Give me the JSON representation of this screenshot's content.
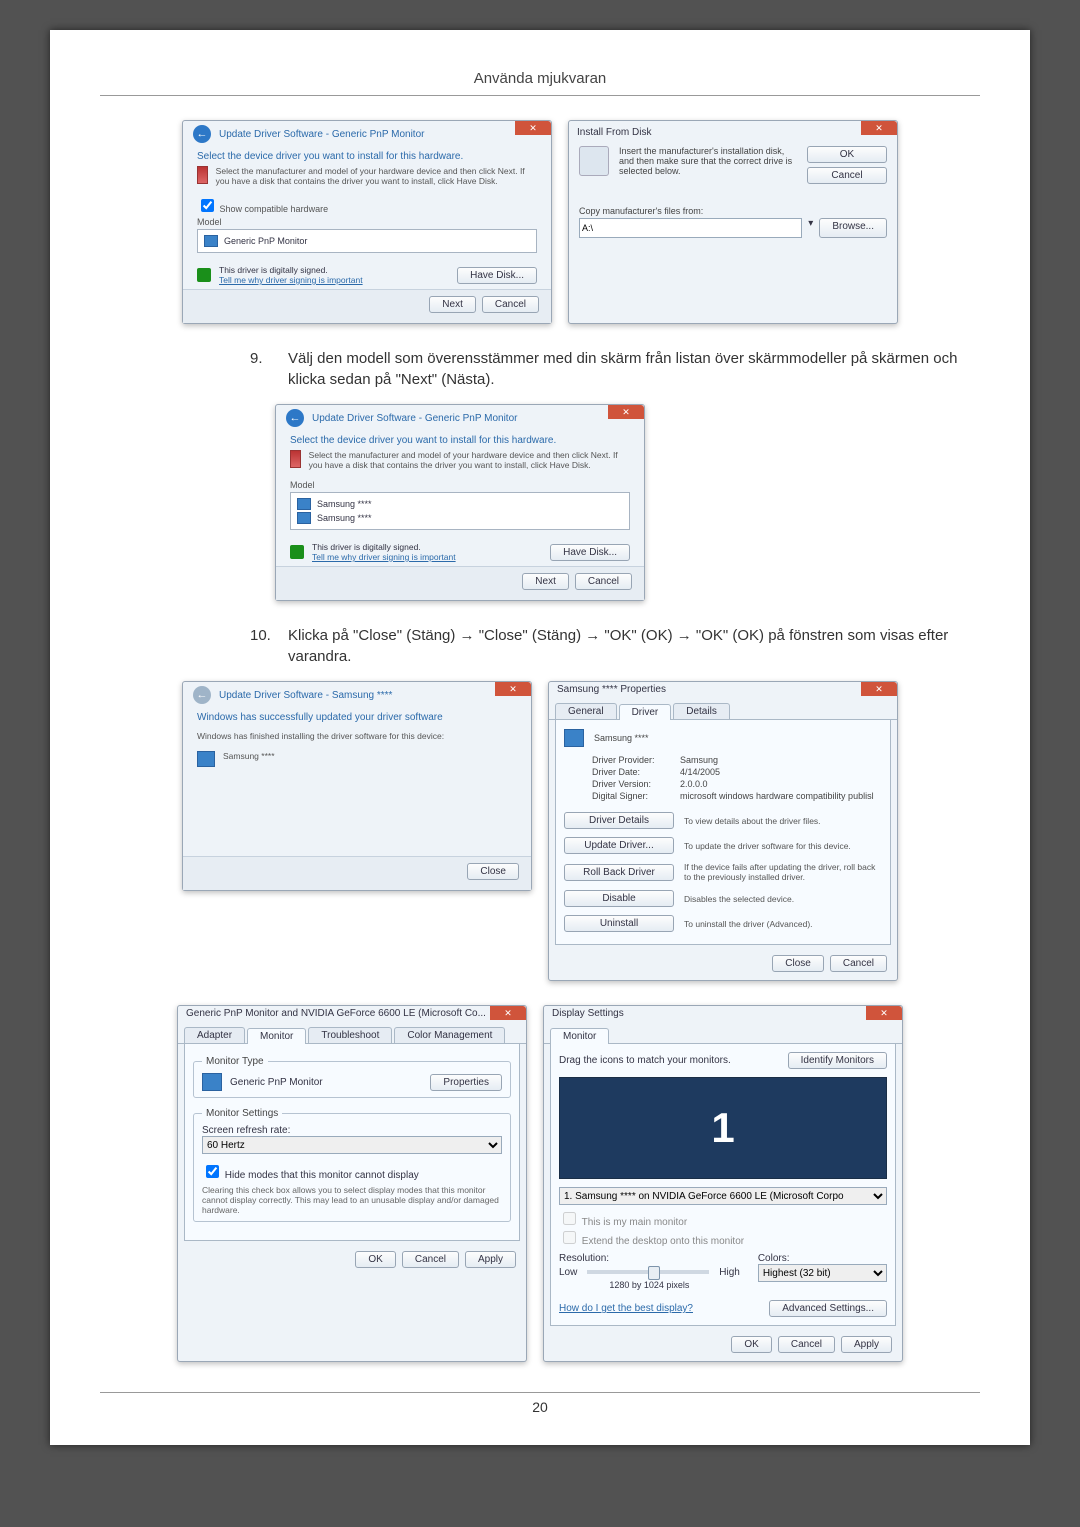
{
  "header_title": "Använda mjukvaran",
  "page_number": "20",
  "step9": {
    "num": "9.",
    "text": "Välj den modell som överensstämmer med din skärm från listan över skärmmodeller på skärmen och klicka sedan på \"Next\" (Nästa)."
  },
  "step10": {
    "num": "10.",
    "text": "Klicka på \"Close\" (Stäng) → \"Close\" (Stäng) → \"OK\" (OK) → \"OK\" (OK) på fönstren som visas efter varandra."
  },
  "wizA": {
    "crumb": "Update Driver Software - Generic PnP Monitor",
    "title": "Select the device driver you want to install for this hardware.",
    "instr": "Select the manufacturer and model of your hardware device and then click Next. If you have a disk that contains the driver you want to install, click Have Disk.",
    "check_compat": "Show compatible hardware",
    "model_lbl": "Model",
    "model_item": "Generic PnP Monitor",
    "signed": "This driver is digitally signed.",
    "signed_link": "Tell me why driver signing is important",
    "have_disk": "Have Disk...",
    "next": "Next",
    "cancel": "Cancel"
  },
  "ifd": {
    "title": "Install From Disk",
    "msg": "Insert the manufacturer's installation disk, and then make sure that the correct drive is selected below.",
    "ok": "OK",
    "cancel": "Cancel",
    "copy_lbl": "Copy manufacturer's files from:",
    "drive": "A:\\",
    "browse": "Browse..."
  },
  "wizB": {
    "crumb": "Update Driver Software - Generic PnP Monitor",
    "title": "Select the device driver you want to install for this hardware.",
    "instr": "Select the manufacturer and model of your hardware device and then click Next. If you have a disk that contains the driver you want to install, click Have Disk.",
    "model_lbl": "Model",
    "item1": "Samsung ****",
    "item2": "Samsung ****",
    "signed": "This driver is digitally signed.",
    "signed_link": "Tell me why driver signing is important",
    "have_disk": "Have Disk...",
    "next": "Next",
    "cancel": "Cancel"
  },
  "wizC": {
    "crumb": "Update Driver Software - Samsung ****",
    "title": "Windows has successfully updated your driver software",
    "sub": "Windows has finished installing the driver software for this device:",
    "device": "Samsung ****",
    "close": "Close"
  },
  "props": {
    "title": "Samsung **** Properties",
    "tab_general": "General",
    "tab_driver": "Driver",
    "tab_details": "Details",
    "device": "Samsung ****",
    "provider_k": "Driver Provider:",
    "provider_v": "Samsung",
    "date_k": "Driver Date:",
    "date_v": "4/14/2005",
    "ver_k": "Driver Version:",
    "ver_v": "2.0.0.0",
    "signer_k": "Digital Signer:",
    "signer_v": "microsoft windows hardware compatibility publisl",
    "b1": "Driver Details",
    "d1": "To view details about the driver files.",
    "b2": "Update Driver...",
    "d2": "To update the driver software for this device.",
    "b3": "Roll Back Driver",
    "d3": "If the device fails after updating the driver, roll back to the previously installed driver.",
    "b4": "Disable",
    "d4": "Disables the selected device.",
    "b5": "Uninstall",
    "d5": "To uninstall the driver (Advanced).",
    "close": "Close",
    "cancel": "Cancel"
  },
  "mon": {
    "title": "Generic PnP Monitor and NVIDIA GeForce 6600 LE (Microsoft Co...",
    "tab_adapter": "Adapter",
    "tab_monitor": "Monitor",
    "tab_trouble": "Troubleshoot",
    "tab_color": "Color Management",
    "type_legend": "Monitor Type",
    "type_value": "Generic PnP Monitor",
    "properties": "Properties",
    "settings_legend": "Monitor Settings",
    "rate_lbl": "Screen refresh rate:",
    "rate_val": "60 Hertz",
    "hide": "Hide modes that this monitor cannot display",
    "hide_note": "Clearing this check box allows you to select display modes that this monitor cannot display correctly. This may lead to an unusable display and/or damaged hardware.",
    "ok": "OK",
    "cancel": "Cancel",
    "apply": "Apply"
  },
  "disp": {
    "title": "Display Settings",
    "tab": "Monitor",
    "drag": "Drag the icons to match your monitors.",
    "identify": "Identify Monitors",
    "preview_num": "1",
    "select": "1. Samsung **** on NVIDIA GeForce 6600 LE (Microsoft Corpo",
    "main": "This is my main monitor",
    "extend": "Extend the desktop onto this monitor",
    "res_lbl": "Resolution:",
    "low": "Low",
    "high": "High",
    "res_val": "1280 by 1024 pixels",
    "col_lbl": "Colors:",
    "col_val": "Highest (32 bit)",
    "best": "How do I get the best display?",
    "adv": "Advanced Settings...",
    "ok": "OK",
    "cancel": "Cancel",
    "apply": "Apply"
  }
}
